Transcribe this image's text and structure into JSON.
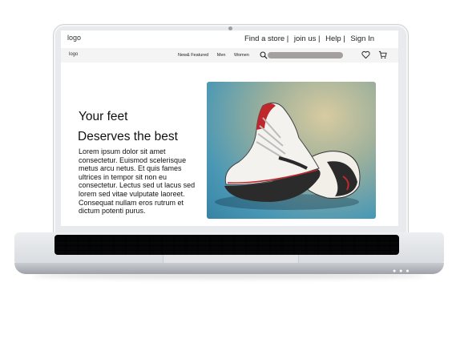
{
  "topbar": {
    "logo": "logo",
    "links": [
      "Find a store |",
      "join us |",
      "Help |",
      "Sign In"
    ]
  },
  "navbar": {
    "logo": "logo",
    "links": [
      "New& Featured",
      "Men",
      "Women"
    ]
  },
  "hero": {
    "title": "Your feet",
    "subtitle": "Deserves the best",
    "body": "Lorem ipsum dolor sit amet consectetur. Euismod scelerisque metus arcu netus. Et quis fames ultrices in tempor sit non eu consectetur. Lectus sed ut lacus sed lorem sed vitae vulputate laoreet. Consequat nullam eros rutrum et dictum potenti purus."
  },
  "icons": [
    "search-icon",
    "heart-icon",
    "cart-icon"
  ],
  "colors": {
    "search_bar": "#a59f9f",
    "navbar_bg": "#f4f4f4"
  }
}
